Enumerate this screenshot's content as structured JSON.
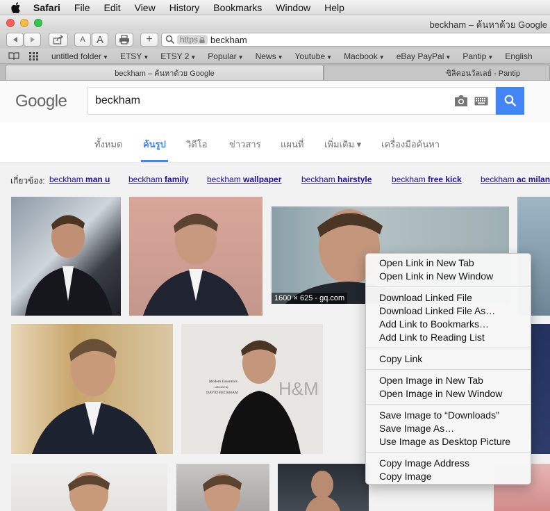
{
  "menubar": {
    "app": "Safari",
    "items": [
      "File",
      "Edit",
      "View",
      "History",
      "Bookmarks",
      "Window",
      "Help"
    ]
  },
  "window": {
    "title": "beckham – ค้นหาด้วย Google"
  },
  "toolbar": {
    "font_small": "A",
    "font_large": "A",
    "new_tab": "+",
    "address_scheme": "https",
    "address_value": "beckham"
  },
  "bookmarks": [
    "untitled folder",
    "ETSY",
    "ETSY 2",
    "Popular",
    "News",
    "Youtube",
    "Macbook",
    "eBay PayPal",
    "Pantip",
    "English"
  ],
  "tabs": [
    {
      "label": "beckham – ค้นหาด้วย Google",
      "active": true
    },
    {
      "label": "ซิลิคอนวัลเลย์ - Pantip",
      "active": false
    }
  ],
  "google": {
    "logo": "Google",
    "query": "beckham",
    "nav": [
      "ทั้งหมด",
      "ค้นรูป",
      "วิดีโอ",
      "ข่าวสาร",
      "แผนที่",
      "เพิ่มเติม",
      "เครื่องมือค้นหา"
    ],
    "nav_more_arrow": "▾",
    "related_label": "เกี่ยวข้อง:",
    "related": [
      {
        "prefix": "beckham ",
        "bold": "man u"
      },
      {
        "prefix": "beckham ",
        "bold": "family"
      },
      {
        "prefix": "beckham ",
        "bold": "wallpaper"
      },
      {
        "prefix": "beckham ",
        "bold": "hairstyle"
      },
      {
        "prefix": "beckham ",
        "bold": "free kick"
      },
      {
        "prefix": "beckham ",
        "bold": "ac milan"
      }
    ],
    "image_caption": "1600 × 625 - gq.com",
    "poster_line1": "Modern Essentials",
    "poster_line2": "selected by",
    "poster_line3": "DAVID BECKHAM",
    "poster_brand": "H&M"
  },
  "context_menu": {
    "groups": [
      [
        "Open Link in New Tab",
        "Open Link in New Window"
      ],
      [
        "Download Linked File",
        "Download Linked File As…",
        "Add Link to Bookmarks…",
        "Add Link to Reading List"
      ],
      [
        "Copy Link"
      ],
      [
        "Open Image in New Tab",
        "Open Image in New Window"
      ],
      [
        "Save Image to “Downloads”",
        "Save Image As…",
        "Use Image as Desktop Picture"
      ],
      [
        "Copy Image Address",
        "Copy Image"
      ]
    ]
  },
  "colors": {
    "google_blue": "#4285f4",
    "link": "#1a0dab",
    "results_bg": "#f2f2f2"
  }
}
